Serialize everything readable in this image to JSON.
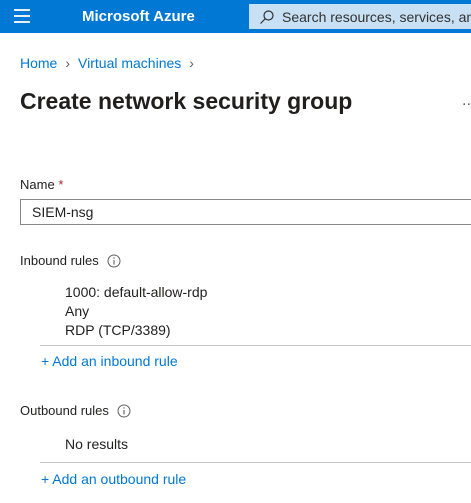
{
  "topbar": {
    "brand": "Microsoft Azure",
    "search_placeholder": "Search resources, services, and docs"
  },
  "breadcrumb": {
    "items": [
      "Home",
      "Virtual machines"
    ]
  },
  "page": {
    "title": "Create network security group",
    "more": "..."
  },
  "form": {
    "name_label": "Name",
    "required_mark": "*",
    "name_value": "SIEM-nsg"
  },
  "inbound": {
    "label": "Inbound rules",
    "rule": {
      "name": "1000: default-allow-rdp",
      "source": "Any",
      "service": "RDP (TCP/3389)"
    },
    "add_link": "+ Add an inbound rule"
  },
  "outbound": {
    "label": "Outbound rules",
    "empty_text": "No results",
    "add_link": "+ Add an outbound rule"
  },
  "colors": {
    "accent": "#0078d4",
    "search_bg": "#c7e0f4",
    "required": "#a4262c"
  }
}
